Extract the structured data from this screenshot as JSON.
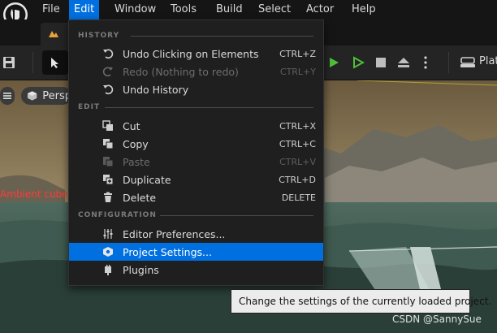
{
  "menubar": {
    "items": [
      "File",
      "Edit",
      "Window",
      "Tools",
      "Build",
      "Select",
      "Actor",
      "Help"
    ],
    "active": "Edit"
  },
  "toolbar": {
    "platforms_label": "Plat"
  },
  "viewport": {
    "menu_icon": "hamburger-icon",
    "view_mode_label": "Persp",
    "warning_text": "Ambient cubem",
    "watermark": "CSDN @SannySue"
  },
  "edit_menu": {
    "sections": {
      "history": "HISTORY",
      "edit": "EDIT",
      "configuration": "CONFIGURATION"
    },
    "history_items": [
      {
        "label": "Undo Clicking on Elements",
        "shortcut": "CTRL+Z",
        "icon": "undo-icon",
        "enabled": true
      },
      {
        "label": "Redo (Nothing to redo)",
        "shortcut": "CTRL+Y",
        "icon": "redo-icon",
        "enabled": false
      },
      {
        "label": "Undo History",
        "shortcut": "",
        "icon": "history-icon",
        "enabled": true
      }
    ],
    "edit_items": [
      {
        "label": "Cut",
        "shortcut": "CTRL+X",
        "icon": "cut-icon",
        "enabled": true
      },
      {
        "label": "Copy",
        "shortcut": "CTRL+C",
        "icon": "copy-icon",
        "enabled": true
      },
      {
        "label": "Paste",
        "shortcut": "CTRL+V",
        "icon": "paste-icon",
        "enabled": false
      },
      {
        "label": "Duplicate",
        "shortcut": "CTRL+D",
        "icon": "duplicate-icon",
        "enabled": true
      },
      {
        "label": "Delete",
        "shortcut": "DELETE",
        "icon": "trash-icon",
        "enabled": true
      }
    ],
    "configuration_items": [
      {
        "label": "Editor Preferences...",
        "icon": "sliders-icon",
        "enabled": true
      },
      {
        "label": "Project Settings...",
        "icon": "project-settings-icon",
        "enabled": true,
        "highlighted": true
      },
      {
        "label": "Plugins",
        "icon": "plugin-icon",
        "enabled": true
      }
    ]
  },
  "tooltip": {
    "text": "Change the settings of the currently loaded project."
  },
  "colors": {
    "accent": "#0070e0",
    "menu_bg": "#1f1f1f",
    "play_green": "#4fbf3a",
    "warning_red": "#ff3a3a"
  }
}
